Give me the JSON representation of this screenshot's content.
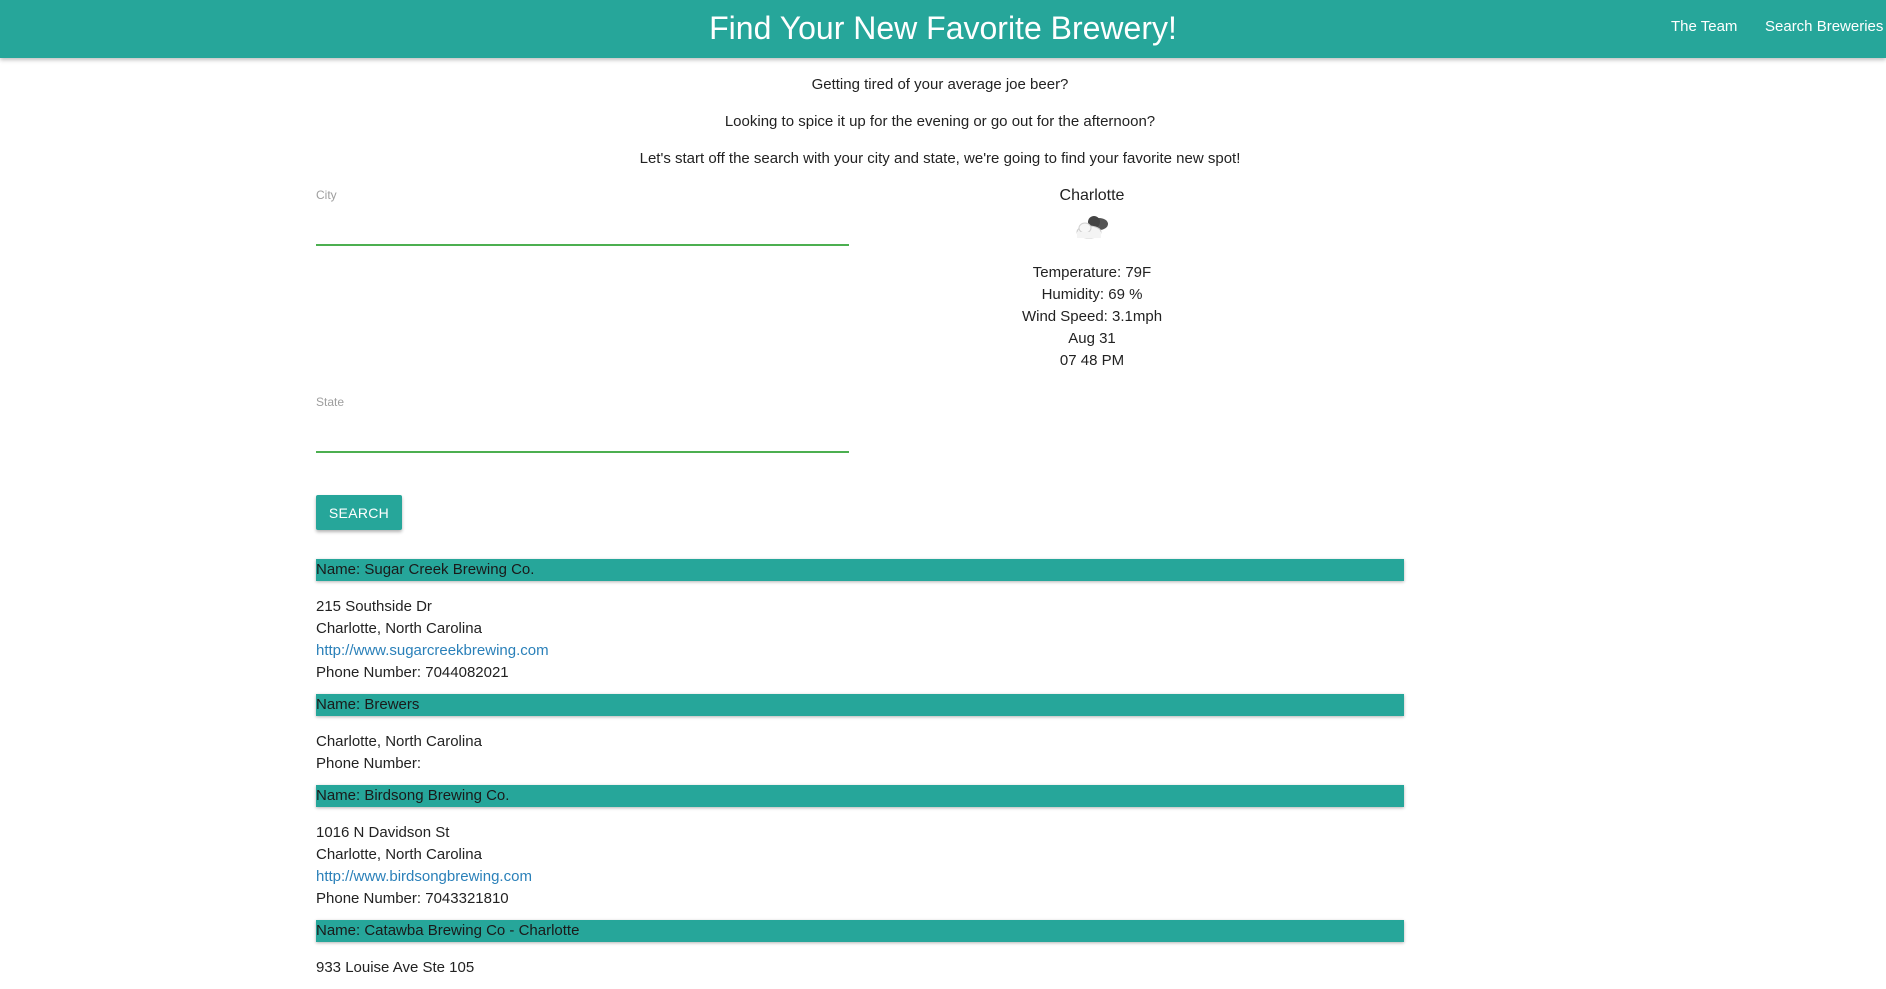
{
  "header": {
    "title": "Find Your New Favorite Brewery!",
    "nav": [
      "The Team",
      "Search Breweries"
    ]
  },
  "intro": [
    "Getting tired of your average joe beer?",
    "Looking to spice it up for the evening or go out for the afternoon?",
    "Let's start off the search with your city and state, we're going to find your favorite new spot!"
  ],
  "form": {
    "city_label": "City",
    "city_value": "",
    "state_label": "State",
    "state_value": "",
    "search_label": "SEARCH"
  },
  "weather": {
    "city": "Charlotte",
    "icon": "partly-cloudy-night-icon",
    "temperature": "Temperature: 79F",
    "humidity": "Humidity: 69 %",
    "wind": "Wind Speed: 3.1mph",
    "date": "Aug 31",
    "time": "07 48 PM"
  },
  "breweries": [
    {
      "name": "Name: Sugar Creek Brewing Co.",
      "lines": [
        {
          "text": "215 Southside Dr",
          "link": false
        },
        {
          "text": "Charlotte, North Carolina",
          "link": false
        },
        {
          "text": "http://www.sugarcreekbrewing.com",
          "link": true
        },
        {
          "text": "Phone Number: 7044082021",
          "link": false
        }
      ]
    },
    {
      "name": "Name: Brewers",
      "lines": [
        {
          "text": "Charlotte, North Carolina",
          "link": false
        },
        {
          "text": "Phone Number:",
          "link": false
        }
      ]
    },
    {
      "name": "Name: Birdsong Brewing Co.",
      "lines": [
        {
          "text": "1016 N Davidson St",
          "link": false
        },
        {
          "text": "Charlotte, North Carolina",
          "link": false
        },
        {
          "text": "http://www.birdsongbrewing.com",
          "link": true
        },
        {
          "text": "Phone Number: 7043321810",
          "link": false
        }
      ]
    },
    {
      "name": "Name: Catawba Brewing Co - Charlotte",
      "lines": [
        {
          "text": "933 Louise Ave Ste 105",
          "link": false
        }
      ]
    }
  ]
}
